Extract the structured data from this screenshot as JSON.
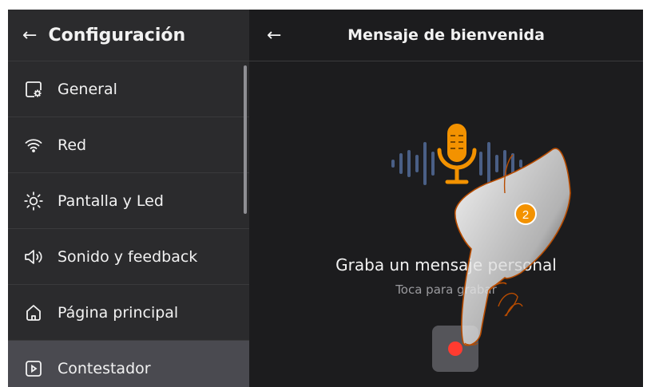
{
  "sidebar": {
    "back_label": "←",
    "title": "Configuración",
    "items": [
      {
        "label": "General",
        "icon": "settings-screen-icon"
      },
      {
        "label": "Red",
        "icon": "wifi-icon"
      },
      {
        "label": "Pantalla y Led",
        "icon": "sun-icon"
      },
      {
        "label": "Sonido y feedback",
        "icon": "speaker-icon"
      },
      {
        "label": "Página principal",
        "icon": "home-icon"
      },
      {
        "label": "Contestador",
        "icon": "play-icon"
      }
    ]
  },
  "main": {
    "back_label": "←",
    "title": "Mensaje de bienvenida",
    "record_title": "Graba un mensaje personal",
    "record_sub": "Toca para grabar"
  },
  "annotation": {
    "step": "2"
  },
  "colors": {
    "accent": "#f39200",
    "record": "#ff3b30",
    "active": "#4a4a50"
  }
}
